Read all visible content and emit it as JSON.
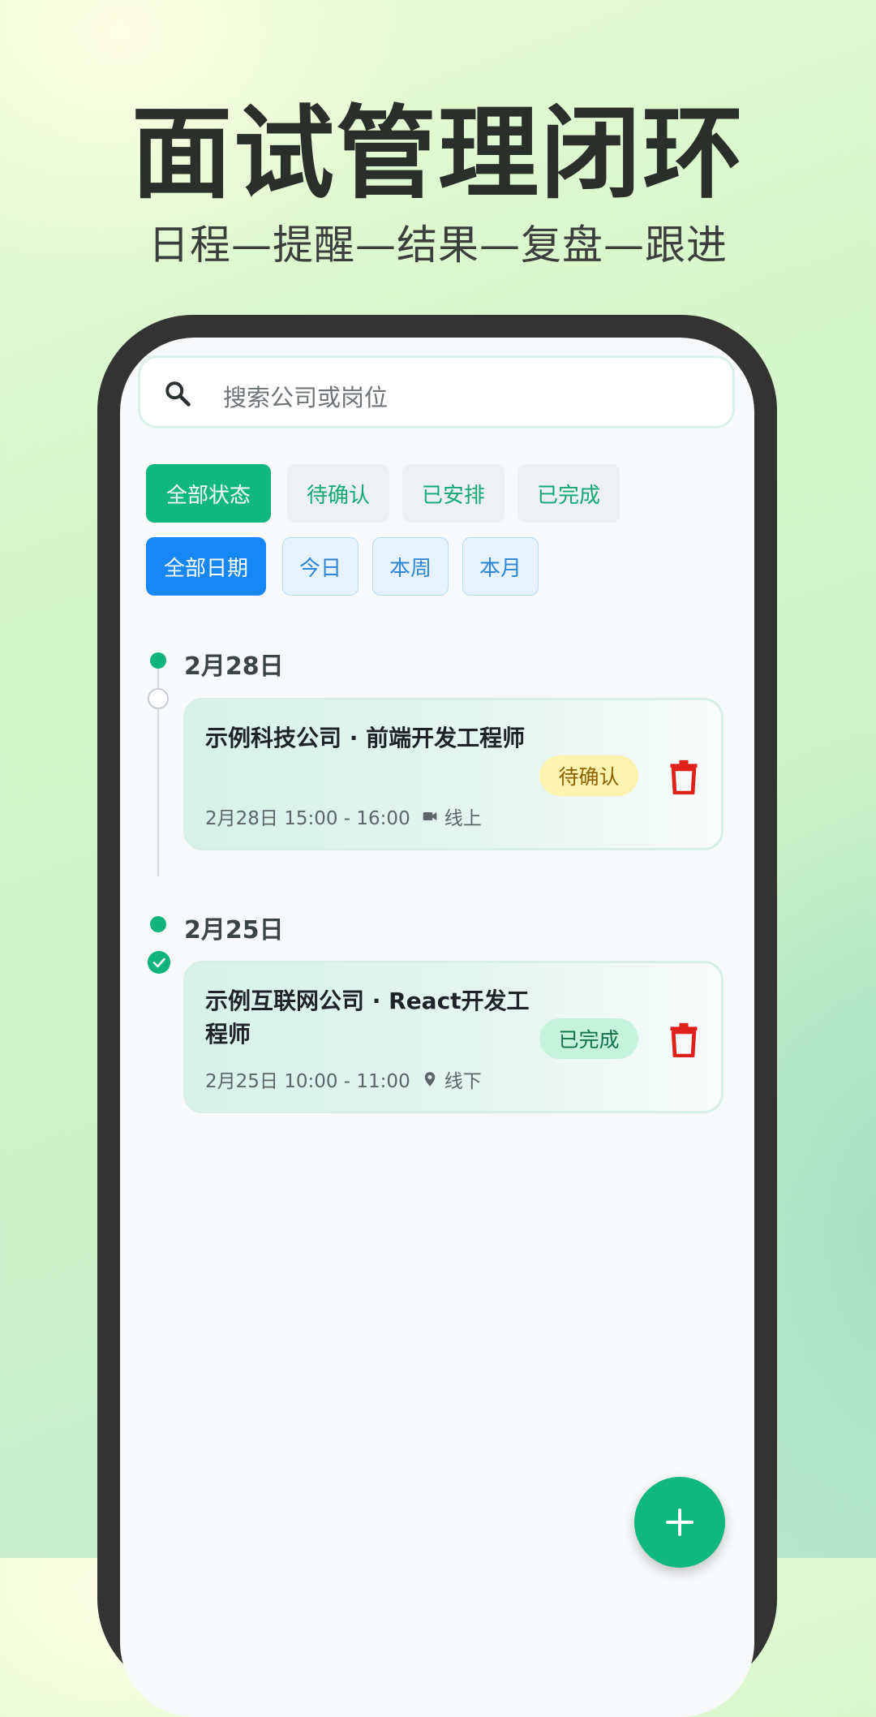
{
  "headline": "面试管理闭环",
  "subheadline": "日程—提醒—结果—复盘—跟进",
  "search": {
    "placeholder": "搜索公司或岗位",
    "icon": "search-icon"
  },
  "status_filters": [
    {
      "label": "全部状态",
      "selected": true
    },
    {
      "label": "待确认",
      "selected": false
    },
    {
      "label": "已安排",
      "selected": false
    },
    {
      "label": "已完成",
      "selected": false
    }
  ],
  "date_filters": [
    {
      "label": "全部日期",
      "selected": true
    },
    {
      "label": "今日",
      "selected": false
    },
    {
      "label": "本周",
      "selected": false
    },
    {
      "label": "本月",
      "selected": false
    }
  ],
  "groups": [
    {
      "date": "2月28日",
      "interview": {
        "title": "示例科技公司 · 前端开发工程师",
        "time": "2月28日 15:00 - 16:00",
        "mode": "线上",
        "mode_icon": "video-icon",
        "status": "待确认",
        "status_color": "#fdf2b0"
      }
    },
    {
      "date": "2月25日",
      "interview": {
        "title": "示例互联网公司 · React开发工程师",
        "time": "2月25日 10:00 - 11:00",
        "mode": "线下",
        "mode_icon": "location-pin-icon",
        "status": "已完成",
        "status_color": "#c5f3dd"
      }
    }
  ],
  "colors": {
    "accent_green": "#10b77e",
    "accent_blue": "#1687f5",
    "delete_red": "#e0201a"
  },
  "fab_icon": "plus-icon"
}
